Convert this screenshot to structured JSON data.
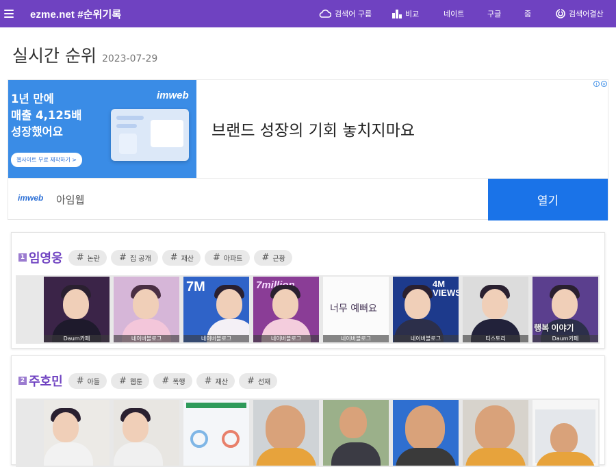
{
  "brand": "ezme.net #순위기록",
  "nav": {
    "cloud": "검색어 구름",
    "compare": "비교",
    "naver": "네이트",
    "google": "구글",
    "zoom": "줌",
    "settle": "검색어결산"
  },
  "icons": [
    "hamburger-icon",
    "cloud-icon",
    "bar-chart-icon",
    "spiral-icon",
    "ad-info-icon",
    "ad-close-icon"
  ],
  "page": {
    "title": "실시간 순위",
    "date": "2023-07-29"
  },
  "ad": {
    "line1": "1년 만에",
    "line2": "매출 4,125배",
    "line3": "성장했어요",
    "cta": "웹사이트 무료 제작하기 >",
    "brand_logo": "imweb",
    "headline": "브랜드 성장의 기회 놓치지마요",
    "advertiser": "아임웹",
    "open": "열기",
    "colors": {
      "visual": "#3a8ce6",
      "button": "#1a73e8"
    }
  },
  "accent": "#6f42c1",
  "rankings": [
    {
      "rank": "1",
      "keyword": "임영웅",
      "tags": [
        "논란",
        "집 공개",
        "재산",
        "아파트",
        "근황"
      ],
      "thumbs": [
        {
          "caption": "Daum카페"
        },
        {
          "caption": "네이버블로그"
        },
        {
          "caption": "네이버블로그",
          "overlay": "7M"
        },
        {
          "caption": "네이버블로그",
          "overlay": "7million"
        },
        {
          "caption": "네이버블로그",
          "overlay": "너무 예뻐요"
        },
        {
          "caption": "네이버블로그",
          "overlay": "4M VIEWS"
        },
        {
          "caption": "티스토리"
        },
        {
          "caption": "Daum카페",
          "overlay": "행복 이야기"
        }
      ]
    },
    {
      "rank": "2",
      "keyword": "주호민",
      "tags": [
        "아들",
        "웹툰",
        "폭행",
        "재산",
        "선재"
      ],
      "thumbs": [
        {
          "caption": ""
        },
        {
          "caption": ""
        },
        {
          "caption": ""
        },
        {
          "caption": ""
        },
        {
          "caption": ""
        },
        {
          "caption": ""
        },
        {
          "caption": ""
        },
        {
          "caption": ""
        }
      ]
    }
  ]
}
